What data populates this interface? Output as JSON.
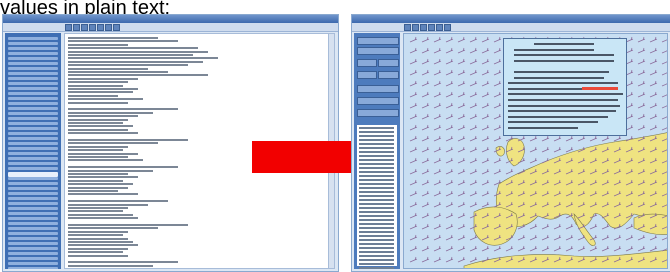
{
  "caption": "values in plain text:",
  "colors": {
    "window_frame": "#8aa9cf",
    "sidebar_blue": "#3f6fb4",
    "sea": "#c8def2",
    "land": "#efe381",
    "arrow_red": "#f20000",
    "wind_barb": "#8a6a9a"
  },
  "left_window": {
    "icon": "list-icon"
  },
  "arrow": {
    "icon": "right-arrow-icon"
  },
  "right_window": {
    "icon": "map-icon"
  }
}
